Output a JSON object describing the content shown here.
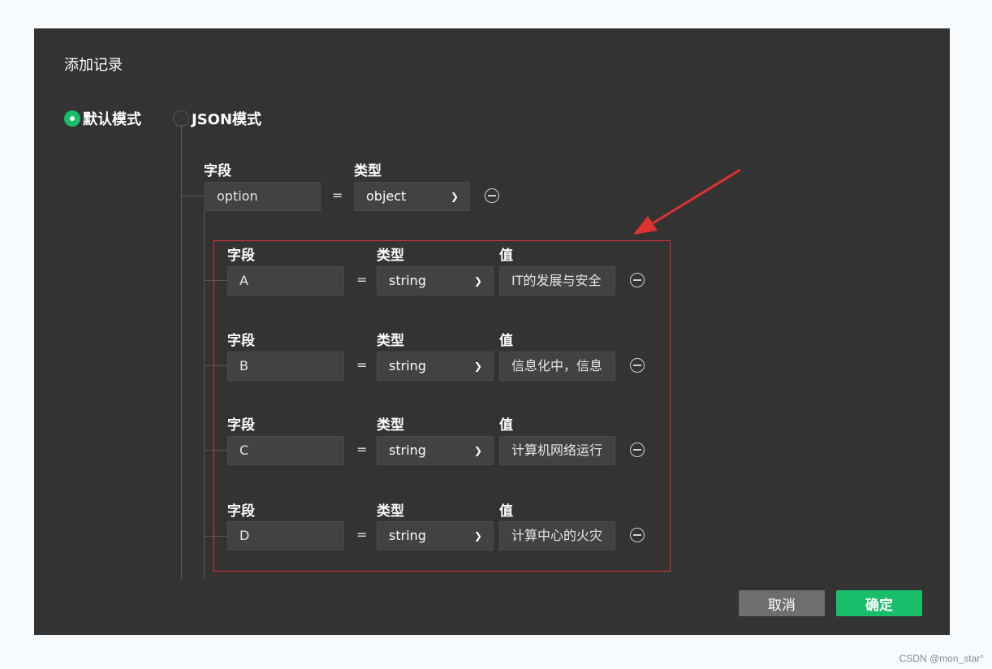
{
  "dialog": {
    "title": "添加记录",
    "modes": [
      {
        "label": "默认模式",
        "checked": true
      },
      {
        "label": "JSON模式",
        "checked": false
      }
    ],
    "parent": {
      "field_label": "字段",
      "type_label": "类型",
      "field_value": "option",
      "equals": "=",
      "type_value": "object"
    },
    "children": [
      {
        "field_label": "字段",
        "type_label": "类型",
        "value_label": "值",
        "field_value": "A",
        "equals": "=",
        "type_value": "string",
        "value": "IT的发展与安全"
      },
      {
        "field_label": "字段",
        "type_label": "类型",
        "value_label": "值",
        "field_value": "B",
        "equals": "=",
        "type_value": "string",
        "value": "信息化中，信息"
      },
      {
        "field_label": "字段",
        "type_label": "类型",
        "value_label": "值",
        "field_value": "C",
        "equals": "=",
        "type_value": "string",
        "value": "计算机网络运行"
      },
      {
        "field_label": "字段",
        "type_label": "类型",
        "value_label": "值",
        "field_value": "D",
        "equals": "=",
        "type_value": "string",
        "value": "计算中心的火灾"
      }
    ],
    "buttons": {
      "cancel": "取消",
      "ok": "确定"
    }
  },
  "annotation": {
    "highlight_color": "#e03131"
  },
  "colors": {
    "accent": "#19be6b",
    "background": "#333333"
  },
  "watermark": "CSDN @mon_star°"
}
